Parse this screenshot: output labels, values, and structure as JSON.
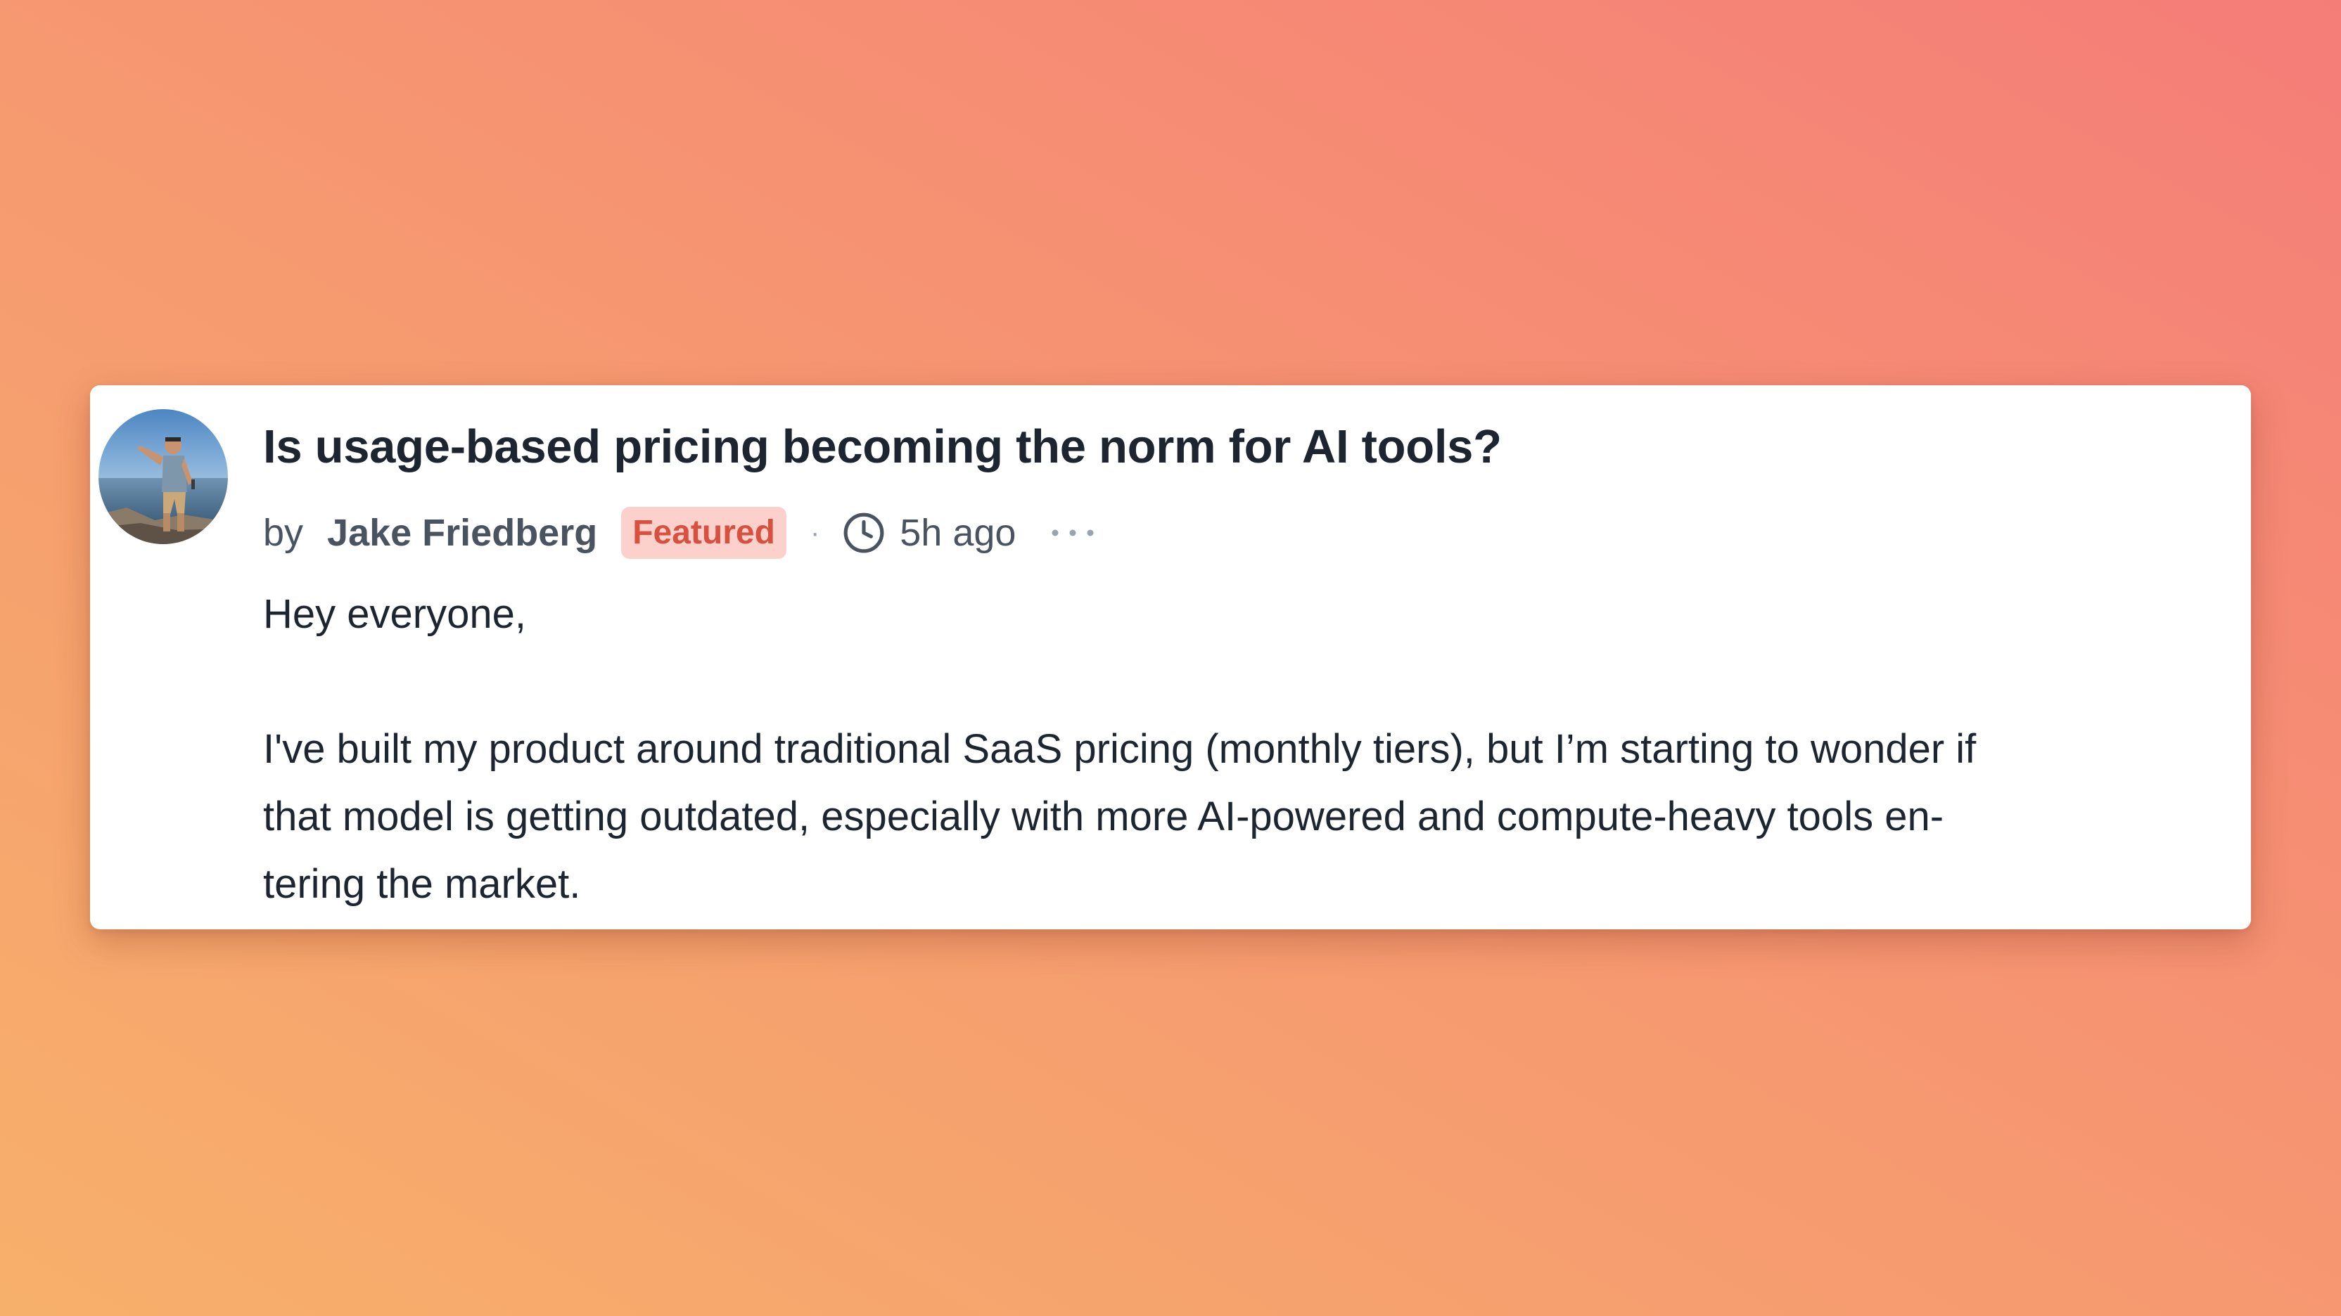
{
  "post": {
    "title": "Is usage-based pricing becoming the norm for AI tools?",
    "meta": {
      "by_label": "by",
      "author": "Jake Friedberg",
      "badge": "Featured",
      "separator": "·",
      "time": "5h ago"
    },
    "body": {
      "greeting": "Hey everyone,",
      "paragraph_lines": [
        "I've built my product around traditional SaaS pricing (monthly tiers), but I’m starting to wonder if",
        "that model is getting outdated, especially with more AI-powered and compute-heavy tools en-",
        "tering the market."
      ]
    }
  },
  "icons": {
    "time": "clock-icon",
    "more": "more-horizontal-icon"
  },
  "colors": {
    "badge_text": "#d8503f",
    "badge_background": "#fcd1cc",
    "title_text": "#1d2630",
    "meta_text": "#4a5460",
    "background_warm": "#f7b06b",
    "background_pink": "#f57d78"
  }
}
